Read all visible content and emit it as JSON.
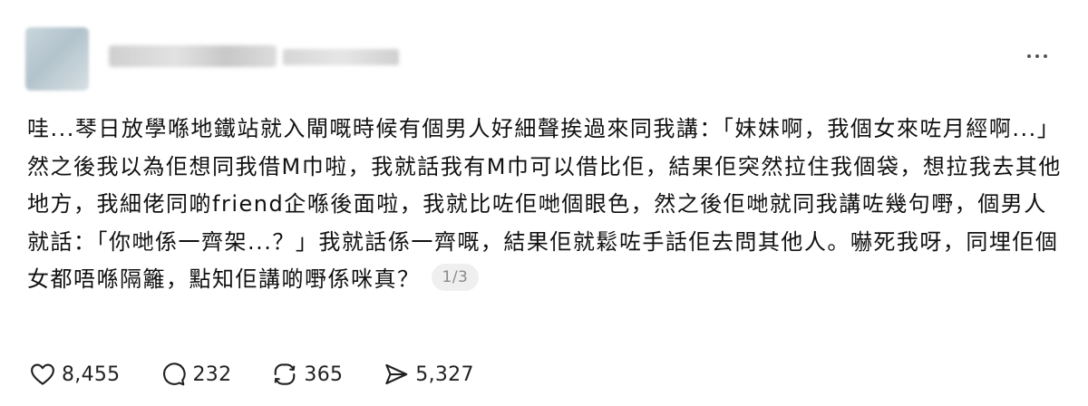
{
  "post": {
    "text": "哇...琴日放學喺地鐵站就入閘嘅時候有個男人好細聲挨過來同我講：「妹妹啊，我個女來咗月經啊...」然之後我以為佢想同我借M巾啦，我就話我有M巾可以借比佢，結果佢突然拉住我個袋，想拉我去其他地方，我細佬同啲friend企喺後面啦，我就比咗佢哋個眼色，然之後佢哋就同我講咗幾句嘢，個男人就話：「你哋係一齊架...？」我就話係一齊嘅，結果佢就鬆咗手話佢去問其他人。嚇死我呀，同埋佢個女都唔喺隔籬，點知佢講啲嘢係咪真？",
    "page_indicator": "1/3"
  },
  "actions": {
    "likes": "8,455",
    "comments": "232",
    "reposts": "365",
    "shares": "5,327"
  },
  "icons": {
    "more": "more-horizontal-icon",
    "like": "heart-icon",
    "comment": "comment-bubble-icon",
    "repost": "repost-arrows-icon",
    "share": "send-icon"
  },
  "colors": {
    "text": "#111111",
    "muted": "#8a8a8a",
    "pill_bg": "#efefef"
  }
}
